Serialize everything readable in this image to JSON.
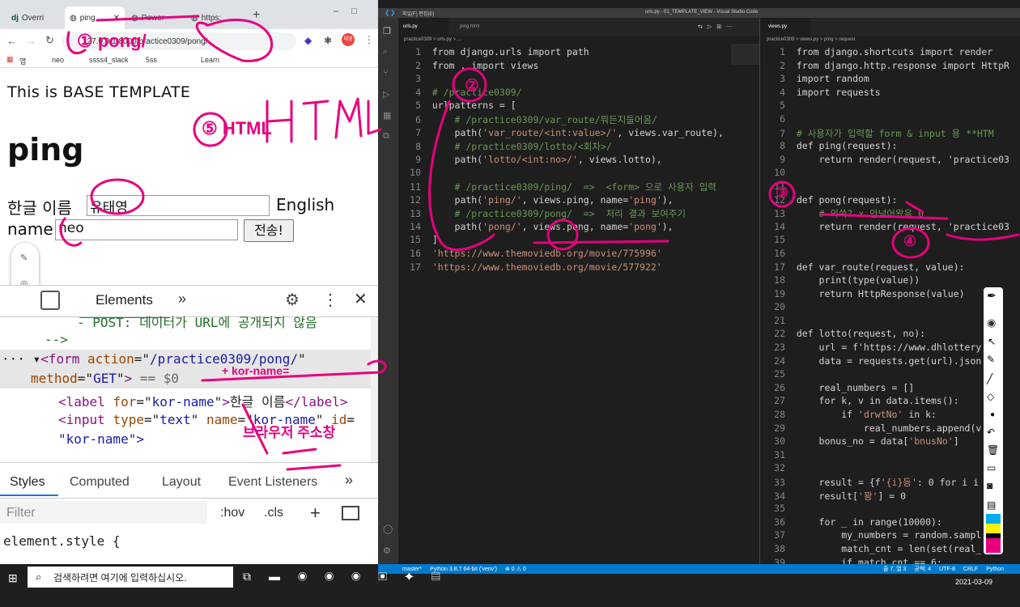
{
  "browser": {
    "tabs": [
      "Overri",
      "ping",
      "Power",
      "https:"
    ],
    "url": "127.0.0.1:8000/practice0309/pong/",
    "profile": "태영",
    "bookmarks": [
      "앱",
      "neo",
      "ssss4_slack",
      "5ss",
      "Learn"
    ],
    "page": {
      "base_text": "This is BASE TEMPLATE",
      "heading": "ping",
      "kor_label": "한글 이름",
      "kor_value": "유태영",
      "eng_label1": "English",
      "eng_label2": "name",
      "eng_value": "neo",
      "submit": "전송!"
    }
  },
  "devtools": {
    "tab_elements": "Elements",
    "line_comment": "- POST: 데이터가 URL에 공개되지 않음",
    "line_close": "-->",
    "form_action": "/practice0309/pong/",
    "form_method": "GET",
    "eq": "== $0",
    "label_line_for": "kor-name",
    "label_line_text": "한글 이름",
    "input_line1_type": "text",
    "input_line1_name": "kor-name",
    "input_line2_id": "\"kor-name\">",
    "styles_tabs": [
      "Styles",
      "Computed",
      "Layout",
      "Event Listeners"
    ],
    "filter": "Filter",
    "hov": ":hov",
    "cls": ".cls",
    "element_style": "element.style {"
  },
  "vscode": {
    "title": "urls.py - 01_TEMPLATE_VIEW - Visual Studio Code",
    "menu": "파일(F)  편집(E)",
    "left_tabs": [
      "urls.py",
      "ping.html"
    ],
    "left_breadcrumb": "practice0309 > urls.py > ...",
    "right_tab": "views.py",
    "right_breadcrumb": "practice0309 > views.py > ping > request",
    "urls_lines": [
      [
        "1",
        "from django.urls import path"
      ],
      [
        "2",
        "from . import views"
      ],
      [
        "3",
        ""
      ],
      [
        "4",
        "# /practice0309/"
      ],
      [
        "5",
        "urlpatterns = ["
      ],
      [
        "6",
        "    # /practice0309/var_route/뭐든지들어옴/"
      ],
      [
        "7",
        "    path('var_route/<int:value>/', views.var_route),"
      ],
      [
        "8",
        "    # /practice0309/lotto/<회차>/"
      ],
      [
        "9",
        "    path('lotto/<int:no>/', views.lotto),"
      ],
      [
        "10",
        ""
      ],
      [
        "11",
        "    # /practice0309/ping/  =>  <form> 으로 사용자 입력"
      ],
      [
        "12",
        "    path('ping/', views.ping, name='ping'),"
      ],
      [
        "13",
        "    # /practice0309/pong/  =>  처리 결과 보여주기"
      ],
      [
        "14",
        "    path('pong/', views.pong, name='pong'),"
      ],
      [
        "15",
        "]"
      ],
      [
        "16",
        "'https://www.themoviedb.org/movie/775996'"
      ],
      [
        "17",
        "'https://www.themoviedb.org/movie/577922'"
      ]
    ],
    "views_lines": [
      [
        "1",
        "from django.shortcuts import render"
      ],
      [
        "2",
        "from django.http.response import HttpR"
      ],
      [
        "3",
        "import random"
      ],
      [
        "4",
        "import requests"
      ],
      [
        "5",
        ""
      ],
      [
        "6",
        ""
      ],
      [
        "7",
        "# 사용자가 입력할 form & input 용 **HTM"
      ],
      [
        "8",
        "def ping(request):"
      ],
      [
        "9",
        "    return render(request, 'practice03"
      ],
      [
        "10",
        ""
      ],
      [
        "11",
        ""
      ],
      [
        "12",
        "def pong(request):"
      ],
      [
        "13",
        "    # 의쓱? x 안넘어왔음 0"
      ],
      [
        "14",
        "    return render(request, 'practice03"
      ],
      [
        "15",
        ""
      ],
      [
        "16",
        ""
      ],
      [
        "17",
        "def var_route(request, value):"
      ],
      [
        "18",
        "    print(type(value))"
      ],
      [
        "19",
        "    return HttpResponse(value)"
      ],
      [
        "20",
        ""
      ],
      [
        "21",
        ""
      ],
      [
        "22",
        "def lotto(request, no):"
      ],
      [
        "23",
        "    url = f'https://www.dhlottery"
      ],
      [
        "24",
        "    data = requests.get(url).json"
      ],
      [
        "25",
        ""
      ],
      [
        "26",
        "    real_numbers = []"
      ],
      [
        "27",
        "    for k, v in data.items():"
      ],
      [
        "28",
        "        if 'drwtNo' in k:"
      ],
      [
        "29",
        "            real_numbers.append(v"
      ],
      [
        "30",
        "    bonus_no = data['bnusNo']"
      ],
      [
        "31",
        ""
      ],
      [
        "32",
        ""
      ],
      [
        "33",
        "    result = {f'{i}등': 0 for i i"
      ],
      [
        "34",
        "    result['꽝'] = 0"
      ],
      [
        "35",
        ""
      ],
      [
        "36",
        "    for _ in range(10000):"
      ],
      [
        "37",
        "        my_numbers = random.sampl"
      ],
      [
        "38",
        "        match_cnt = len(set(real_"
      ],
      [
        "39",
        "        if match_cnt == 6:"
      ]
    ],
    "status": {
      "branch": "master*",
      "python": "Python 3.8.7 64-bit ('venv')",
      "errors": "⊗ 0 ⚠ 0",
      "pos": "줄 7, 열 3",
      "spaces": "공백: 4",
      "enc": "UTF-8",
      "eol": "CRLF",
      "lang": "Python"
    }
  },
  "taskbar": {
    "search": "검색하려면 여기에 입력하십시오.",
    "time": "2021-03-09"
  },
  "annotations": {
    "n1": "① pong/",
    "n5": "⑤ HTML",
    "n2": "②",
    "n3": "③",
    "n4": "④",
    "kor": "+ kor-name=",
    "korean_hand": "브라우저 주소창"
  },
  "colors": {
    "ink": "#e6007e",
    "vsblue": "#007acc"
  }
}
